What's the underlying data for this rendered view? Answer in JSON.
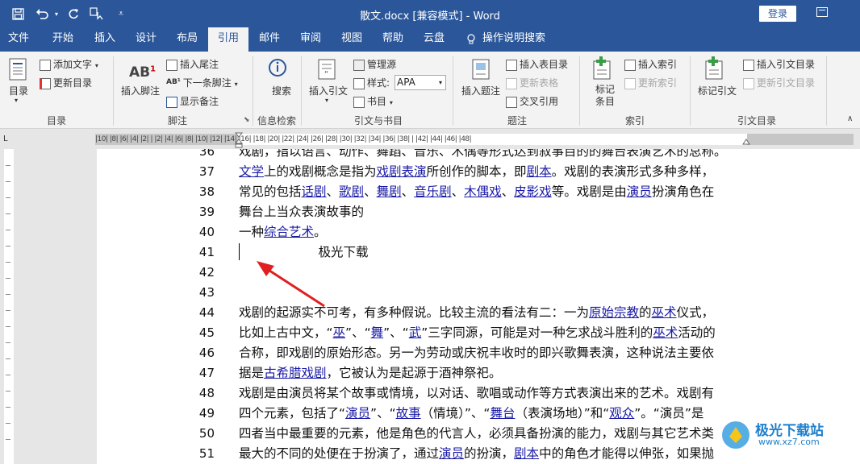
{
  "title_bar": {
    "title": "散文.docx [兼容模式]  -  Word",
    "login": "登录"
  },
  "tabs": [
    "文件",
    "开始",
    "插入",
    "设计",
    "布局",
    "引用",
    "邮件",
    "审阅",
    "视图",
    "帮助",
    "云盘",
    "操作说明搜索"
  ],
  "active_tab": "引用",
  "ribbon": {
    "toc": {
      "big": "目录",
      "add_text": "添加文字",
      "update_toc": "更新目录",
      "group": "目录"
    },
    "footnotes": {
      "big": "插入脚注",
      "ab_label": "AB",
      "insert_endnote": "插入尾注",
      "next_footnote": "下一条脚注",
      "show_notes": "显示备注",
      "group": "脚注"
    },
    "research": {
      "big": "搜索",
      "group": "信息检索"
    },
    "citations": {
      "big": "插入引文",
      "manage_sources": "管理源",
      "style_label": "样式:",
      "style_value": "APA",
      "bibliography": "书目",
      "group": "引文与书目"
    },
    "captions": {
      "big": "插入题注",
      "insert_table_of_figures": "插入表目录",
      "update_table": "更新表格",
      "cross_reference": "交叉引用",
      "group": "题注"
    },
    "index": {
      "big": "标记条目",
      "insert_index": "插入索引",
      "update_index": "更新索引",
      "group": "索引"
    },
    "toa": {
      "big": "标记引文",
      "insert_toa": "插入引文目录",
      "update_toa": "更新引文目录",
      "group": "引文目录"
    }
  },
  "ruler_text": "|10|  |8|  |6|  |4|  |2|  |    |2|  |4|  |6|  |8|  |10|  |12|  |14|  |16|  |18|  |20|  |22|  |24|  |26|  |28|  |30|  |32|  |34|  |36|  |38|   |   |42|  |44|  |46|  |48|",
  "document": {
    "lines": [
      {
        "n": "36",
        "segs": [
          {
            "t": "戏剧，指以语言、动作、舞蹈、音乐、木偶等形式达到叙事目的的舞台表演艺术的总称。",
            "l": false
          }
        ]
      },
      {
        "n": "37",
        "segs": [
          {
            "t": "文学",
            "l": true
          },
          {
            "t": "上的戏剧概念是指为",
            "l": false
          },
          {
            "t": "戏剧表演",
            "l": true
          },
          {
            "t": "所创作的脚本，即",
            "l": false
          },
          {
            "t": "剧本",
            "l": true
          },
          {
            "t": "。戏剧的表演形式多种多样，",
            "l": false
          }
        ]
      },
      {
        "n": "38",
        "segs": [
          {
            "t": "常见的包括",
            "l": false
          },
          {
            "t": "话剧",
            "l": true
          },
          {
            "t": "、",
            "l": false
          },
          {
            "t": "歌剧",
            "l": true
          },
          {
            "t": "、",
            "l": false
          },
          {
            "t": "舞剧",
            "l": true
          },
          {
            "t": "、",
            "l": false
          },
          {
            "t": "音乐剧",
            "l": true
          },
          {
            "t": "、",
            "l": false
          },
          {
            "t": "木偶戏",
            "l": true
          },
          {
            "t": "、",
            "l": false
          },
          {
            "t": "皮影戏",
            "l": true
          },
          {
            "t": "等。戏剧是由",
            "l": false
          },
          {
            "t": "演员",
            "l": true
          },
          {
            "t": "扮演角色在",
            "l": false
          }
        ]
      },
      {
        "n": "39",
        "segs": [
          {
            "t": "舞台上当众表演故事的",
            "l": false
          }
        ]
      },
      {
        "n": "40",
        "segs": [
          {
            "t": "一种",
            "l": false
          },
          {
            "t": "综合艺术",
            "l": true
          },
          {
            "t": "。",
            "l": false
          }
        ]
      },
      {
        "n": "41",
        "segs": [
          {
            "t": "                    极光下载",
            "l": false
          }
        ]
      },
      {
        "n": "42",
        "segs": []
      },
      {
        "n": "43",
        "segs": []
      },
      {
        "n": "44",
        "segs": [
          {
            "t": "戏剧的起源实不可考，有多种假说。比较主流的看法有二：一为",
            "l": false
          },
          {
            "t": "原始宗教",
            "l": true
          },
          {
            "t": "的",
            "l": false
          },
          {
            "t": "巫术",
            "l": true
          },
          {
            "t": "仪式，",
            "l": false
          }
        ]
      },
      {
        "n": "45",
        "segs": [
          {
            "t": "比如上古中文，“",
            "l": false
          },
          {
            "t": "巫",
            "l": true
          },
          {
            "t": "”、“",
            "l": false
          },
          {
            "t": "舞",
            "l": true
          },
          {
            "t": "”、“",
            "l": false
          },
          {
            "t": "武",
            "l": true
          },
          {
            "t": "”三字同源，可能是对一种乞求战斗胜利的",
            "l": false
          },
          {
            "t": "巫术",
            "l": true
          },
          {
            "t": "活动的",
            "l": false
          }
        ]
      },
      {
        "n": "46",
        "segs": [
          {
            "t": "合称，即戏剧的原始形态。另一为劳动或庆祝丰收时的即兴歌舞表演，这种说法主要依",
            "l": false
          }
        ]
      },
      {
        "n": "47",
        "segs": [
          {
            "t": "据是",
            "l": false
          },
          {
            "t": "古希腊戏剧",
            "l": true
          },
          {
            "t": "，它被认为是起源于酒神祭祀。",
            "l": false
          }
        ]
      },
      {
        "n": "48",
        "segs": [
          {
            "t": "戏剧是由演员将某个故事或情境，以对话、歌唱或动作等方式表演出来的艺术。戏剧有",
            "l": false
          }
        ]
      },
      {
        "n": "49",
        "segs": [
          {
            "t": "四个元素，包括了“",
            "l": false
          },
          {
            "t": "演员",
            "l": true
          },
          {
            "t": "”、“",
            "l": false
          },
          {
            "t": "故事",
            "l": true
          },
          {
            "t": "（情境）”、“",
            "l": false
          },
          {
            "t": "舞台",
            "l": true
          },
          {
            "t": "（表演场地）”和“",
            "l": false
          },
          {
            "t": "观众",
            "l": true
          },
          {
            "t": "”。“演员”是",
            "l": false
          }
        ]
      },
      {
        "n": "50",
        "segs": [
          {
            "t": "四者当中最重要的元素，他是角色的代言人，必须具备扮演的能力，戏剧与其它艺术类",
            "l": false
          }
        ]
      },
      {
        "n": "51",
        "segs": [
          {
            "t": "最大的不同的处便在于扮演了，通过",
            "l": false
          },
          {
            "t": "演员",
            "l": true
          },
          {
            "t": "的扮演，",
            "l": false
          },
          {
            "t": "剧本",
            "l": true
          },
          {
            "t": "中的角色才能得以伸张，如果抛",
            "l": false
          }
        ]
      }
    ]
  },
  "watermark": {
    "cn": "极光下载站",
    "url": "www.xz7.com"
  },
  "colors": {
    "brand": "#2b579a",
    "link": "#1a1aa6",
    "arrow": "#e02020"
  }
}
